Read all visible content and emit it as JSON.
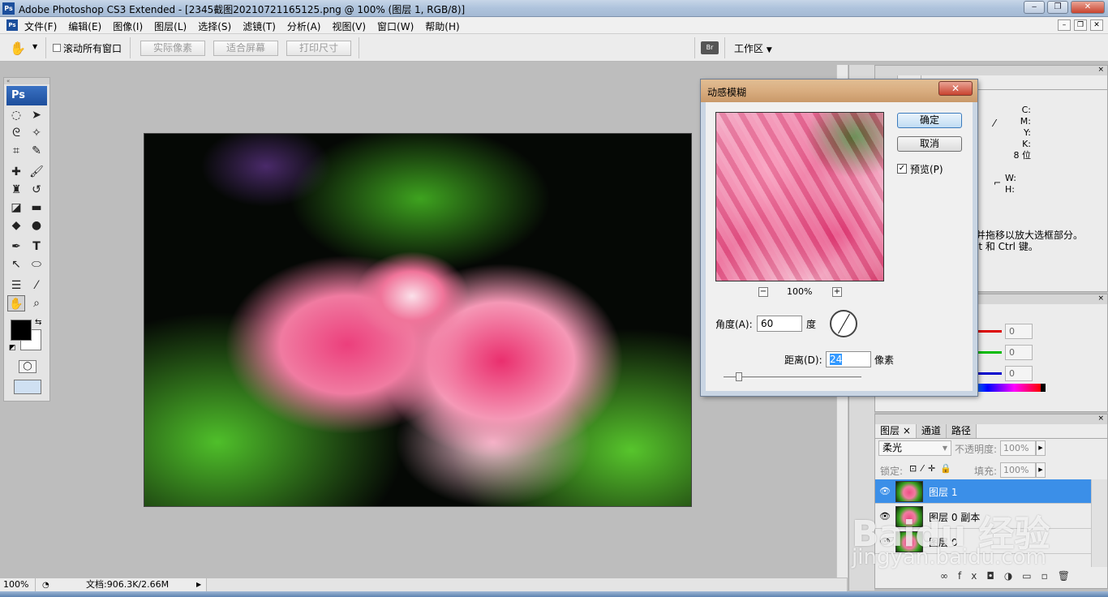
{
  "titlebar": {
    "title": "Adobe Photoshop CS3 Extended - [2345截图20210721165125.png @ 100% (图层 1, RGB/8)]",
    "ps_icon": "Ps",
    "minimize": "‒",
    "restore": "❐",
    "close": "✕"
  },
  "menubar": {
    "items": [
      "文件(F)",
      "编辑(E)",
      "图像(I)",
      "图层(L)",
      "选择(S)",
      "滤镜(T)",
      "分析(A)",
      "视图(V)",
      "窗口(W)",
      "帮助(H)"
    ]
  },
  "options": {
    "scroll_all_label": "滚动所有窗口",
    "actual_pixels": "实际像素",
    "fit_screen": "适合屏幕",
    "print_size": "打印尺寸",
    "workspace": "工作区"
  },
  "toolbox": {
    "logo": "Ps"
  },
  "dialog": {
    "title": "动感模糊",
    "ok": "确定",
    "cancel": "取消",
    "preview_label": "预览(P)",
    "preview_checked": true,
    "zoom": "100%",
    "zoom_out": "−",
    "zoom_in": "+",
    "angle_label": "角度(A):",
    "angle_value": "60",
    "angle_unit": "度",
    "distance_label": "距离(D):",
    "distance_value": "24",
    "distance_unit": "像素"
  },
  "info_panel": {
    "c": "C:",
    "m": "M:",
    "y": "Y:",
    "k": "K:",
    "bits": "8 位",
    "w": "W:",
    "h": "H:",
    "hint_line1": "并拖移以放大选框部分。",
    "hint_line2": "lt 和 Ctrl 键。"
  },
  "color_panel": {
    "r": "0",
    "g": "0",
    "b": "0"
  },
  "layers_panel": {
    "tabs": [
      "图层",
      "通道",
      "路径"
    ],
    "blend_mode": "柔光",
    "opacity_label": "不透明度:",
    "opacity_value": "100%",
    "lock_label": "锁定:",
    "fill_label": "填充:",
    "fill_value": "100%",
    "layers": [
      {
        "name": "图层 1",
        "selected": true
      },
      {
        "name": "图层 0 副本",
        "selected": false
      },
      {
        "name": "图层 0",
        "selected": false
      }
    ]
  },
  "status": {
    "zoom": "100%",
    "doc_info": "文档:906.3K/2.66M"
  },
  "watermark": {
    "logo_text": "Baidu 经验",
    "url": "jingyan.baidu.com"
  }
}
